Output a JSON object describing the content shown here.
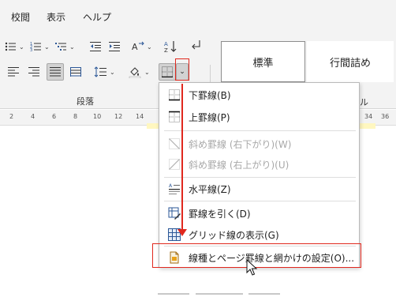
{
  "tabs": [
    {
      "label": "校閲"
    },
    {
      "label": "表示"
    },
    {
      "label": "ヘルプ"
    }
  ],
  "ribbon": {
    "group_label": "段落",
    "styles": [
      {
        "label": "標準"
      },
      {
        "label": "行間詰め"
      }
    ],
    "partial_label": "ル"
  },
  "ruler": {
    "numbers": [
      "2",
      "4",
      "6",
      "8",
      "10",
      "12",
      "14",
      "34",
      "36"
    ]
  },
  "border_menu": {
    "items": [
      {
        "label": "下罫線(B)",
        "icon": "bottom-border-icon",
        "enabled": true
      },
      {
        "label": "上罫線(P)",
        "icon": "top-border-icon",
        "enabled": true
      },
      {
        "label": "斜め罫線 (右下がり)(W)",
        "icon": "diagonal-down-border-icon",
        "enabled": false
      },
      {
        "label": "斜め罫線 (右上がり)(U)",
        "icon": "diagonal-up-border-icon",
        "enabled": false
      },
      {
        "label": "水平線(Z)",
        "icon": "horizontal-line-icon",
        "enabled": true
      },
      {
        "label": "罫線を引く(D)",
        "icon": "draw-table-icon",
        "enabled": true
      },
      {
        "label": "グリッド線の表示(G)",
        "icon": "view-gridlines-icon",
        "enabled": true
      },
      {
        "label": "線種とページ罫線と網かけの設定(O)...",
        "icon": "borders-and-shading-icon",
        "enabled": true
      }
    ]
  },
  "colors": {
    "accent_red": "#e0281e",
    "ribbon_bg": "#f3f3f3",
    "highlight": "#fff7c0",
    "icon_blue": "#2b5797"
  }
}
